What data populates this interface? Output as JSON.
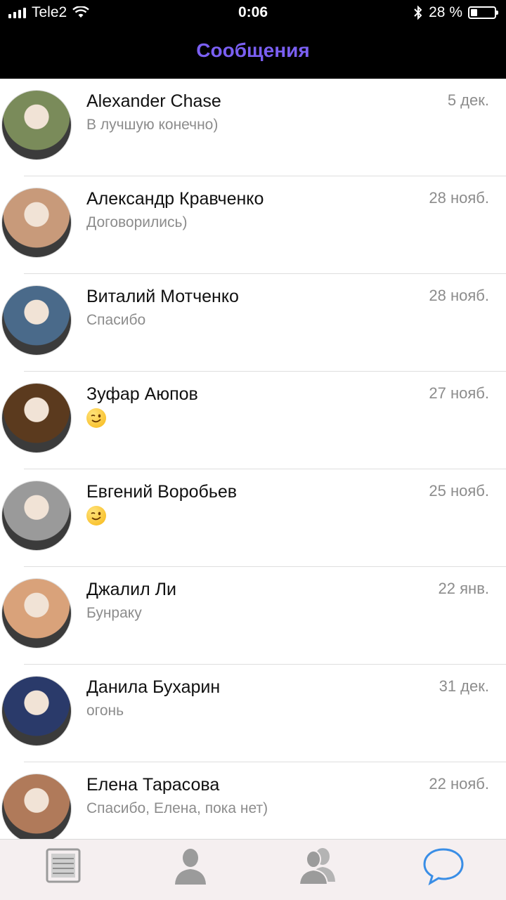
{
  "status_bar": {
    "carrier": "Tele2",
    "time": "0:06",
    "battery": "28 %",
    "battery_level": 0.28
  },
  "header": {
    "title": "Сообщения"
  },
  "conversations": [
    {
      "name": "Alexander Chase",
      "message": "В лучшую конечно)",
      "date": "5 дек.",
      "avatar_color": "#7a8b5a"
    },
    {
      "name": "Александр Кравченко",
      "message": "Договорились)",
      "date": "28 нояб.",
      "avatar_color": "#c89a7a"
    },
    {
      "name": "Виталий Мотченко",
      "message": "Спасибо",
      "date": "28 нояб.",
      "avatar_color": "#4a6a8a"
    },
    {
      "name": "Зуфар Аюпов",
      "message": "",
      "message_icon": "wink-emoji-icon",
      "date": "27 нояб.",
      "avatar_color": "#5b3a1e"
    },
    {
      "name": "Евгений Воробьев",
      "message": "",
      "message_icon": "wink-emoji-icon",
      "date": "25 нояб.",
      "avatar_color": "#9a9a9a"
    },
    {
      "name": "Джалил Ли",
      "message": "Бунраку",
      "date": "22 янв.",
      "avatar_color": "#d9a27a"
    },
    {
      "name": "Данила Бухарин",
      "message": "огонь",
      "date": "31 дек.",
      "avatar_color": "#2a3a6a"
    },
    {
      "name": "Елена Тарасова",
      "message": "Спасибо, Елена, пока нет)",
      "date": "22 нояб.",
      "avatar_color": "#b07a5a"
    }
  ],
  "tabbar": {
    "tabs": [
      {
        "icon": "news-icon",
        "active": false
      },
      {
        "icon": "profile-icon",
        "active": false
      },
      {
        "icon": "friends-icon",
        "active": false
      },
      {
        "icon": "messages-icon",
        "active": true
      }
    ],
    "active_color": "#3a8ee6",
    "inactive_color": "#9b9b9b"
  }
}
